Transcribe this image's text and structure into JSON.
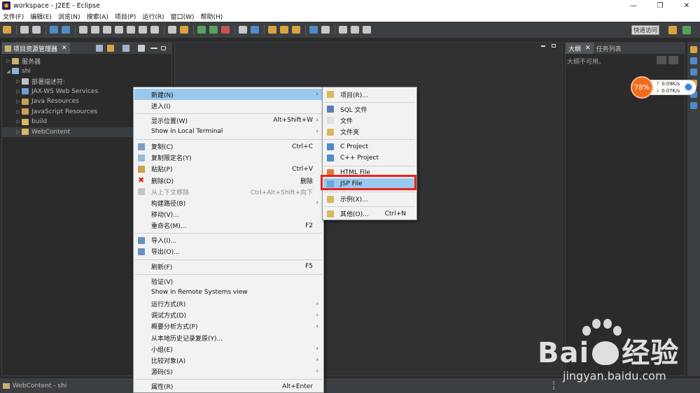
{
  "window": {
    "title": "workspace - J2EE - Eclipse",
    "controls": [
      "—",
      "❐",
      "✕"
    ]
  },
  "menubar": [
    "文件(F)",
    "编辑(E)",
    "浏览(N)",
    "搜索(A)",
    "项目(P)",
    "运行(R)",
    "窗口(W)",
    "帮助(H)"
  ],
  "toolbar": {
    "quick_access": "快速访问"
  },
  "left_panel": {
    "tab_label": "项目资源管理器",
    "close": "✕",
    "tree": [
      {
        "label": "服务器",
        "indent": 0,
        "arrow": "▷",
        "icon": "folder-icon",
        "color": "#c8b070"
      },
      {
        "label": "shi",
        "indent": 0,
        "arrow": "◢",
        "icon": "project-icon",
        "color": "#8fb0d8"
      },
      {
        "label": "部署描述符:",
        "indent": 1,
        "arrow": "▷",
        "icon": "deployment-icon",
        "color": "#c0c0c0"
      },
      {
        "label": "JAX-WS Web Services",
        "indent": 1,
        "arrow": "▷",
        "icon": "webservice-icon",
        "color": "#6a9fd8"
      },
      {
        "label": "Java Resources",
        "indent": 1,
        "arrow": "▷",
        "icon": "java-resources-icon",
        "color": "#c8a050"
      },
      {
        "label": "JavaScript Resources",
        "indent": 1,
        "arrow": "▷",
        "icon": "javascript-resources-icon",
        "color": "#c8a050"
      },
      {
        "label": "build",
        "indent": 1,
        "arrow": "▷",
        "icon": "folder-icon",
        "color": "#d8b860"
      },
      {
        "label": "WebContent",
        "indent": 1,
        "arrow": "▷",
        "icon": "folder-icon",
        "color": "#d8b860"
      }
    ]
  },
  "outline_panel": {
    "tab_label": "大纲",
    "close": "✕",
    "tasks_label": "任务列表",
    "empty_text": "大纲不可用。"
  },
  "net_widget": {
    "percent": "78%",
    "up": "0.09K/s",
    "down": "0.07K/s"
  },
  "statusbar": {
    "text": "WebContent - shi"
  },
  "context_menu": {
    "items": [
      {
        "label": "新建(N)",
        "shortcut": "",
        "sub": true,
        "highlight": true,
        "icon": ""
      },
      {
        "label": "进入(I)",
        "shortcut": "",
        "sub": false,
        "icon": ""
      },
      {
        "sep": true
      },
      {
        "label": "显示位置(W)",
        "shortcut": "Alt+Shift+W",
        "sub": true,
        "icon": ""
      },
      {
        "label": "Show in Local Terminal",
        "shortcut": "",
        "sub": true,
        "icon": ""
      },
      {
        "sep": true
      },
      {
        "label": "复制(C)",
        "shortcut": "Ctrl+C",
        "sub": false,
        "icon": "copy-icon"
      },
      {
        "label": "复制限定名(Y)",
        "shortcut": "",
        "sub": false,
        "icon": "copy-qualified-name-icon"
      },
      {
        "label": "粘贴(P)",
        "shortcut": "Ctrl+V",
        "sub": false,
        "icon": "paste-icon"
      },
      {
        "label": "删除(D)",
        "shortcut": "删除",
        "sub": false,
        "icon": "delete-icon"
      },
      {
        "label": "从上下文移除",
        "shortcut": "Ctrl+Alt+Shift+向下",
        "sub": false,
        "disabled": true,
        "icon": "remove-from-context-icon"
      },
      {
        "label": "构建路径(B)",
        "shortcut": "",
        "sub": true,
        "icon": ""
      },
      {
        "label": "移动(V)...",
        "shortcut": "",
        "sub": false,
        "icon": ""
      },
      {
        "label": "重命名(M)...",
        "shortcut": "F2",
        "sub": false,
        "icon": ""
      },
      {
        "sep": true
      },
      {
        "label": "导入(I)...",
        "shortcut": "",
        "sub": false,
        "icon": "import-icon"
      },
      {
        "label": "导出(O)...",
        "shortcut": "",
        "sub": false,
        "icon": "export-icon"
      },
      {
        "sep": true
      },
      {
        "label": "刷新(F)",
        "shortcut": "F5",
        "sub": false,
        "icon": ""
      },
      {
        "sep": true
      },
      {
        "label": "验证(V)",
        "shortcut": "",
        "sub": false,
        "icon": ""
      },
      {
        "label": "Show in Remote Systems view",
        "shortcut": "",
        "sub": false,
        "icon": ""
      },
      {
        "label": "运行方式(R)",
        "shortcut": "",
        "sub": true,
        "icon": ""
      },
      {
        "label": "调试方式(D)",
        "shortcut": "",
        "sub": true,
        "icon": ""
      },
      {
        "label": "概要分析方式(P)",
        "shortcut": "",
        "sub": true,
        "icon": ""
      },
      {
        "label": "从本地历史记录复原(Y)...",
        "shortcut": "",
        "sub": false,
        "icon": ""
      },
      {
        "label": "小组(E)",
        "shortcut": "",
        "sub": true,
        "icon": ""
      },
      {
        "label": "比较对象(A)",
        "shortcut": "",
        "sub": true,
        "icon": ""
      },
      {
        "label": "源码(S)",
        "shortcut": "",
        "sub": true,
        "icon": ""
      },
      {
        "sep": true
      },
      {
        "label": "属性(R)",
        "shortcut": "Alt+Enter",
        "sub": false,
        "icon": ""
      }
    ]
  },
  "submenu": {
    "items": [
      {
        "label": "项目(R)...",
        "shortcut": "",
        "icon": "new-project-icon"
      },
      {
        "sep": true
      },
      {
        "label": "SQL 文件",
        "shortcut": "",
        "icon": "sql-file-icon"
      },
      {
        "label": "文件",
        "shortcut": "",
        "icon": "file-icon"
      },
      {
        "label": "文件夹",
        "shortcut": "",
        "icon": "folder-icon"
      },
      {
        "sep": true
      },
      {
        "label": "C Project",
        "shortcut": "",
        "icon": "c-project-icon"
      },
      {
        "label": "C++ Project",
        "shortcut": "",
        "icon": "cpp-project-icon"
      },
      {
        "sep": true
      },
      {
        "label": "HTML File",
        "shortcut": "",
        "icon": "html-file-icon"
      },
      {
        "label": "JSP File",
        "shortcut": "",
        "icon": "jsp-file-icon",
        "highlight": true
      },
      {
        "sep": true
      },
      {
        "label": "示例(X)...",
        "shortcut": "",
        "icon": "example-icon"
      },
      {
        "sep": true
      },
      {
        "label": "其他(O)...",
        "shortcut": "Ctrl+N",
        "icon": "other-icon"
      }
    ]
  },
  "watermark": {
    "brand": "Bai",
    "brand2": "经验",
    "url": "jingyan.baidu.com"
  }
}
